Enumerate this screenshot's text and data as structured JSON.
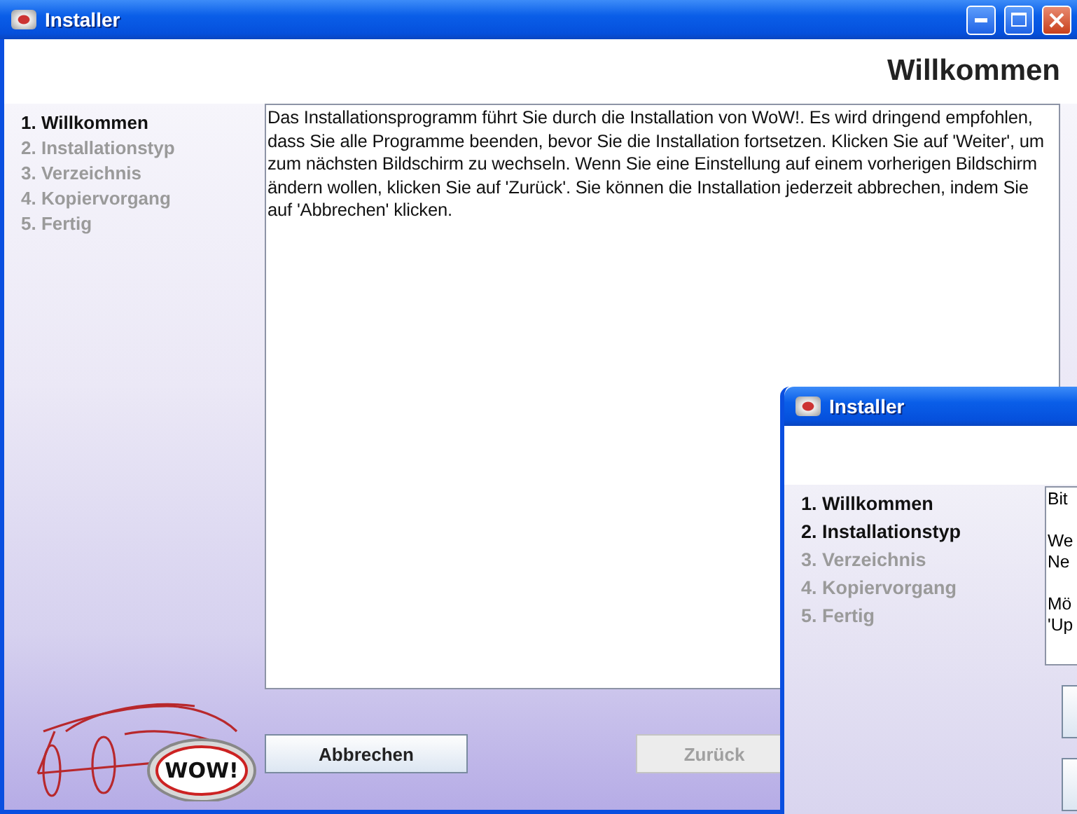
{
  "window": {
    "title": "Installer"
  },
  "page_title": "Willkommen",
  "steps": [
    {
      "label": "1. Willkommen",
      "active": true
    },
    {
      "label": "2. Installationstyp",
      "active": false
    },
    {
      "label": "3. Verzeichnis",
      "active": false
    },
    {
      "label": "4. Kopiervorgang",
      "active": false
    },
    {
      "label": "5. Fertig",
      "active": false
    }
  ],
  "description": "Das Installationsprogramm führt Sie durch die Installation von WoW!.  Es wird dringend empfohlen, dass Sie alle Programme beenden, bevor Sie die Installation fortsetzen.  Klicken Sie auf 'Weiter', um zum nächsten Bildschirm zu wechseln. Wenn Sie eine Einstellung auf einem vorherigen Bildschirm ändern wollen, klicken Sie auf 'Zurück'.  Sie können die Installation jederzeit abbrechen, indem Sie auf 'Abbrechen' klicken.",
  "logo": {
    "text": "WOW!"
  },
  "buttons": [
    {
      "label": "Abbrechen",
      "disabled": false
    },
    {
      "label": "Zurück",
      "disabled": true
    }
  ],
  "second_window": {
    "title": "Installer",
    "steps": [
      {
        "label": "1. Willkommen",
        "active": true
      },
      {
        "label": "2. Installationstyp",
        "active": true
      },
      {
        "label": "3. Verzeichnis",
        "active": false
      },
      {
        "label": "4. Kopiervorgang",
        "active": false
      },
      {
        "label": "5. Fertig",
        "active": false
      }
    ],
    "paragraphs": [
      {
        "lines": [
          "Bit"
        ]
      },
      {
        "lines": [
          "We",
          "Ne"
        ]
      },
      {
        "lines": [
          "Mö",
          "'Up"
        ]
      }
    ]
  }
}
